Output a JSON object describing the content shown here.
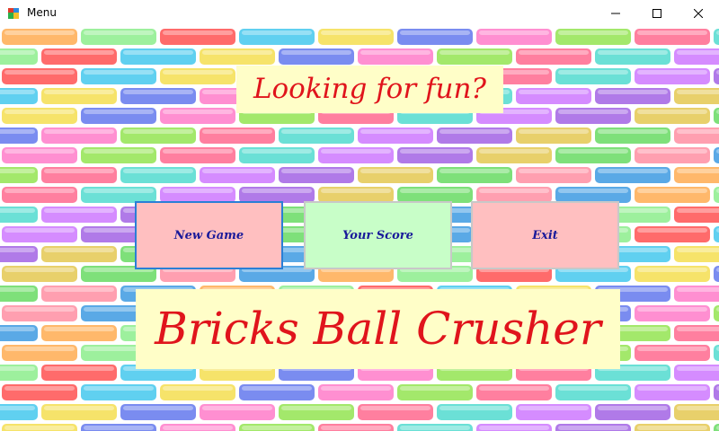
{
  "window": {
    "title": "Menu",
    "icon": "windows-form-icon",
    "controls": [
      "minimize-icon",
      "maximize-icon",
      "close-icon"
    ]
  },
  "background": {
    "pattern": "colorful-bricks",
    "brick_colors": [
      "#5aa9e6",
      "#ff8fd1",
      "#7ee07a",
      "#f6e36a",
      "#b07ae8",
      "#ff6b6b",
      "#6be0d6",
      "#ffb86b",
      "#a3e86b",
      "#ff9fb0",
      "#7a8cf0",
      "#e8d06b",
      "#60d0f0",
      "#d58cff",
      "#9df09d",
      "#ff7f9f"
    ]
  },
  "header": {
    "text": "Looking for fun?",
    "color": "#e0141c",
    "background": "#fffec8"
  },
  "buttons": {
    "new_game": "New Game",
    "your_score": "Your Score",
    "exit": "Exit"
  },
  "footer": {
    "title": "Bricks Ball Crusher",
    "color": "#e0141c",
    "background": "#fffec8"
  }
}
